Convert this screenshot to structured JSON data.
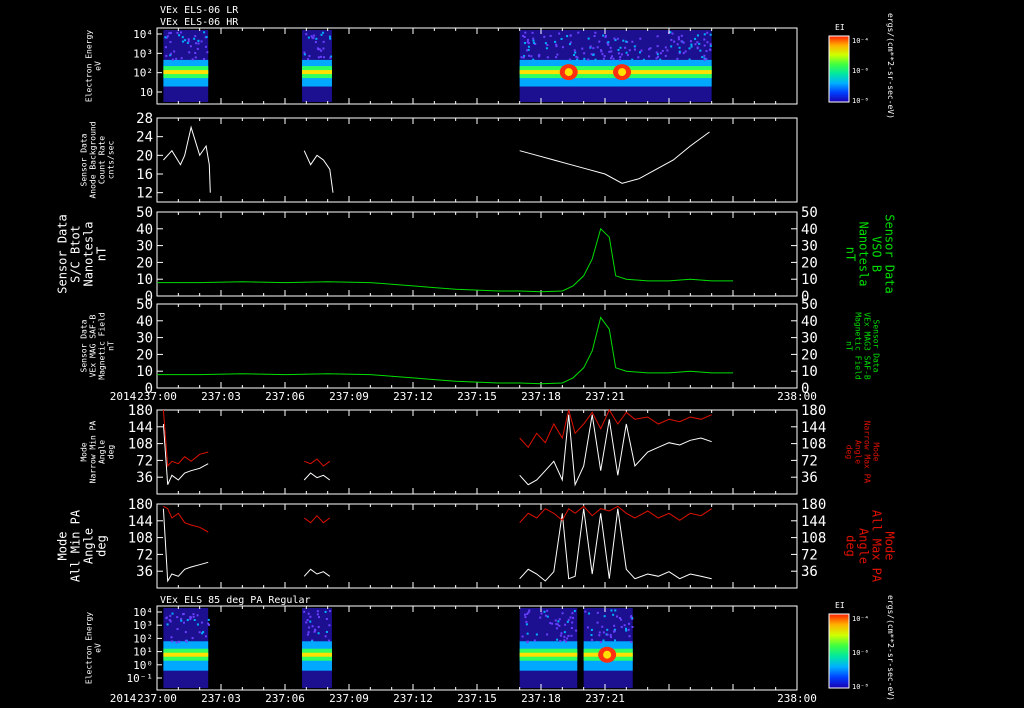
{
  "header": {
    "line1": "VEx ELS-06 LR",
    "line2": "VEx ELS-06 HR",
    "bottom_title": "VEx ELS 85 deg PA Regular"
  },
  "colors": {
    "background": "#000000",
    "white": "#ffffff",
    "green": "#00dd00",
    "red": "#dd1100"
  },
  "time_axis": {
    "year": "2014",
    "ticks": [
      "237:00",
      "237:03",
      "237:06",
      "237:09",
      "237:12",
      "237:15",
      "237:18",
      "237:21",
      "238:00"
    ],
    "range_minutes": [
      0,
      30
    ]
  },
  "colorbar": {
    "label": "EI",
    "ticks": [
      "10⁻⁴",
      "10⁻⁶",
      "10⁻⁸"
    ],
    "units": "ergs/(cm**2-sr-sec-eV)"
  },
  "chart_data": [
    {
      "type": "heatmap",
      "name": "elec-energy-top",
      "ylabel": [
        "Electron Energy",
        "eV"
      ],
      "yticks": [
        "10⁴",
        "10³",
        "10²",
        "10"
      ],
      "segments": [
        [
          0.3,
          2.4
        ],
        [
          6.8,
          8.2
        ],
        [
          17.0,
          22.5
        ],
        [
          22.5,
          26.0
        ]
      ],
      "features": [
        {
          "t": 19.3,
          "type": "hot-blob"
        },
        {
          "t": 21.8,
          "type": "hot-blob"
        }
      ]
    },
    {
      "type": "line",
      "name": "anode-background",
      "ylabel": [
        "Sensor Data",
        "Anode Background",
        "Count Rate",
        "cnts/sec"
      ],
      "yticks": [
        12,
        16,
        20,
        24,
        28
      ],
      "ylim": [
        10,
        28
      ],
      "segments": [
        {
          "t": [
            0.3,
            0.7,
            1.1,
            1.3,
            1.6,
            2.0,
            2.3,
            2.45,
            2.5
          ],
          "y": [
            19,
            21,
            18,
            20,
            26,
            20,
            22,
            18,
            12
          ]
        },
        {
          "t": [
            6.9,
            7.2,
            7.5,
            7.8,
            8.1,
            8.25
          ],
          "y": [
            21,
            18,
            20,
            19,
            17,
            12
          ]
        },
        {
          "t": [
            17.0,
            17.8,
            18.6,
            19.4,
            20.2,
            21.0,
            21.8,
            22.6,
            23.4,
            24.2,
            25.0,
            25.9
          ],
          "y": [
            21,
            20,
            19,
            18,
            17,
            16,
            14,
            15,
            17,
            19,
            22,
            25
          ]
        }
      ]
    },
    {
      "type": "line",
      "name": "sc-btot",
      "ylabel": [
        "Sensor Data",
        "S/C Btot",
        "Nanotesla",
        "nT"
      ],
      "ylabel_right": [
        "Sensor Data",
        "VSO B",
        "Nanotesla",
        "nT"
      ],
      "yticks": [
        0,
        10,
        20,
        30,
        40,
        50
      ],
      "ylim": [
        0,
        50
      ],
      "t": [
        0,
        2,
        4,
        6,
        8,
        10,
        11,
        12,
        13,
        14,
        15,
        16,
        17,
        18,
        19,
        19.5,
        20,
        20.4,
        20.8,
        21.2,
        21.5,
        22,
        23,
        24,
        25,
        26,
        27
      ],
      "y": [
        8,
        8,
        8.5,
        8,
        8.5,
        8,
        7,
        6,
        5,
        4,
        3.5,
        3,
        3,
        2.5,
        3,
        6,
        12,
        22,
        40,
        35,
        12,
        10,
        9,
        9,
        10,
        9,
        9
      ]
    },
    {
      "type": "line",
      "name": "mag-field",
      "ylabel": [
        "Sensor Data",
        "VEx MAG SAF-B",
        "Magnetic Field",
        "nT"
      ],
      "ylabel_right": [
        "Sensor Data",
        "VEx MAG3 SAF-B",
        "Magnetic Field",
        "nT"
      ],
      "yticks": [
        0,
        10,
        20,
        30,
        40,
        50
      ],
      "ylim": [
        0,
        50
      ],
      "t": [
        0,
        2,
        4,
        6,
        8,
        10,
        11,
        12,
        13,
        14,
        15,
        16,
        17,
        18,
        19,
        19.5,
        20,
        20.4,
        20.8,
        21.2,
        21.5,
        22,
        23,
        24,
        25,
        26,
        27
      ],
      "y": [
        8,
        8,
        8.5,
        8,
        8.5,
        8,
        7,
        6,
        5,
        4,
        3.5,
        3,
        3,
        2.5,
        3,
        6,
        12,
        22,
        42,
        35,
        12,
        10,
        9,
        9,
        10,
        9,
        9
      ]
    },
    {
      "type": "line",
      "name": "narrow-pa",
      "ylabel": [
        "Mode",
        "Narrow Min PA",
        "Angle",
        "deg"
      ],
      "ylabel_right": [
        "Mode",
        "Narrow Max PA",
        "Angle",
        "deg"
      ],
      "yticks": [
        36,
        72,
        108,
        144,
        180
      ],
      "ylim": [
        0,
        180
      ],
      "series": [
        {
          "color": "white",
          "segments": [
            {
              "t": [
                0.3,
                0.5,
                0.7,
                1.0,
                1.3,
                1.6,
                2.0,
                2.4
              ],
              "y": [
                150,
                20,
                40,
                30,
                45,
                50,
                55,
                65
              ]
            },
            {
              "t": [
                6.9,
                7.2,
                7.5,
                7.8,
                8.1
              ],
              "y": [
                30,
                45,
                35,
                40,
                30
              ]
            },
            {
              "t": [
                17.0,
                17.4,
                17.8,
                18.2,
                18.6,
                19.0,
                19.3,
                19.6,
                20.0,
                20.4,
                20.8,
                21.2,
                21.6,
                22.0,
                22.4,
                23.0,
                23.5,
                24.0,
                24.5,
                25.0,
                25.5,
                26.0
              ],
              "y": [
                40,
                20,
                30,
                50,
                70,
                30,
                170,
                20,
                60,
                170,
                50,
                160,
                40,
                150,
                60,
                90,
                100,
                110,
                105,
                115,
                120,
                112
              ]
            }
          ]
        },
        {
          "color": "red",
          "segments": [
            {
              "t": [
                0.3,
                0.5,
                0.7,
                1.0,
                1.3,
                1.6,
                2.0,
                2.4
              ],
              "y": [
                180,
                60,
                70,
                65,
                80,
                70,
                85,
                90
              ]
            },
            {
              "t": [
                6.9,
                7.2,
                7.5,
                7.8,
                8.1
              ],
              "y": [
                70,
                65,
                75,
                60,
                70
              ]
            },
            {
              "t": [
                17.0,
                17.4,
                17.8,
                18.2,
                18.6,
                19.0,
                19.3,
                19.6,
                20.0,
                20.4,
                20.8,
                21.2,
                21.6,
                22.0,
                22.4,
                23.0,
                23.5,
                24.0,
                24.5,
                25.0,
                25.5,
                26.0
              ],
              "y": [
                120,
                100,
                130,
                110,
                150,
                120,
                180,
                130,
                150,
                175,
                140,
                180,
                150,
                175,
                160,
                165,
                150,
                160,
                155,
                165,
                160,
                170
              ]
            }
          ]
        }
      ]
    },
    {
      "type": "line",
      "name": "all-pa",
      "ylabel": [
        "Mode",
        "All Min PA",
        "Angle",
        "deg"
      ],
      "ylabel_right": [
        "Mode",
        "All Max PA",
        "Angle",
        "deg"
      ],
      "yticks": [
        36,
        72,
        108,
        144,
        180
      ],
      "ylim": [
        0,
        180
      ],
      "series": [
        {
          "color": "white",
          "segments": [
            {
              "t": [
                0.3,
                0.5,
                0.7,
                1.0,
                1.3,
                1.6,
                2.0,
                2.4
              ],
              "y": [
                170,
                15,
                30,
                25,
                40,
                45,
                50,
                55
              ]
            },
            {
              "t": [
                6.9,
                7.2,
                7.5,
                7.8,
                8.1
              ],
              "y": [
                25,
                40,
                30,
                35,
                25
              ]
            },
            {
              "t": [
                17.0,
                17.4,
                17.8,
                18.2,
                18.6,
                19.0,
                19.3,
                19.6,
                20.0,
                20.4,
                20.8,
                21.2,
                21.6,
                22.0,
                22.4,
                23.0,
                23.5,
                24.0,
                24.5,
                25.0,
                25.5,
                26.0
              ],
              "y": [
                20,
                40,
                30,
                15,
                35,
                160,
                20,
                25,
                170,
                30,
                160,
                20,
                170,
                40,
                20,
                30,
                25,
                35,
                20,
                30,
                25,
                20
              ]
            }
          ]
        },
        {
          "color": "red",
          "segments": [
            {
              "t": [
                0.3,
                0.5,
                0.7,
                1.0,
                1.3,
                1.6,
                2.0,
                2.4
              ],
              "y": [
                175,
                170,
                150,
                160,
                140,
                135,
                130,
                120
              ]
            },
            {
              "t": [
                6.9,
                7.2,
                7.5,
                7.8,
                8.1
              ],
              "y": [
                150,
                140,
                155,
                140,
                150
              ]
            },
            {
              "t": [
                17.0,
                17.4,
                17.8,
                18.2,
                18.6,
                19.0,
                19.3,
                19.6,
                20.0,
                20.4,
                20.8,
                21.2,
                21.6,
                22.0,
                22.4,
                23.0,
                23.5,
                24.0,
                24.5,
                25.0,
                25.5,
                26.0
              ],
              "y": [
                140,
                160,
                150,
                170,
                160,
                145,
                170,
                160,
                175,
                155,
                170,
                165,
                175,
                160,
                150,
                165,
                150,
                160,
                145,
                160,
                155,
                170
              ]
            }
          ]
        }
      ]
    },
    {
      "type": "heatmap",
      "name": "elec-energy-bottom",
      "ylabel": [
        "Electron Energy",
        "eV"
      ],
      "yticks": [
        "10⁴",
        "10³",
        "10²",
        "10¹",
        "10⁰",
        "10⁻¹"
      ],
      "segments": [
        [
          0.3,
          2.4
        ],
        [
          6.8,
          8.2
        ],
        [
          17.0,
          19.7
        ],
        [
          20.0,
          22.3
        ]
      ],
      "features": [
        {
          "t": 21.1,
          "type": "hot-blob"
        }
      ]
    }
  ]
}
